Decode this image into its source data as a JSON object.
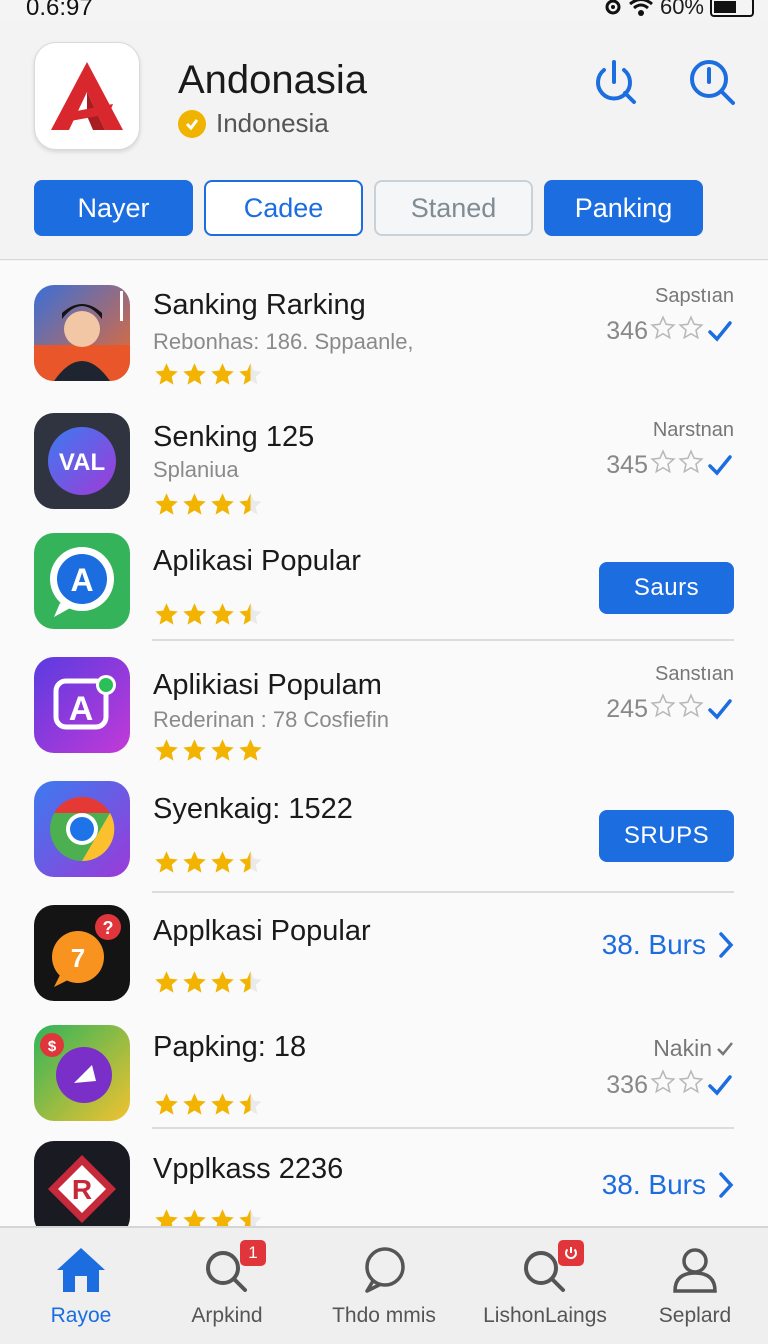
{
  "status_bar": {
    "time": "0.6:97",
    "battery": "60%"
  },
  "header": {
    "app_name": "Andonasia",
    "region": "Indonesia",
    "icons": [
      "power-icon",
      "search-icon"
    ]
  },
  "tabs": [
    {
      "label": "Nayer",
      "style": "filled"
    },
    {
      "label": "Cadee",
      "style": "outline"
    },
    {
      "label": "Staned",
      "style": "muted"
    },
    {
      "label": "Panking",
      "style": "filled"
    }
  ],
  "apps": [
    {
      "title": "Sanking Rarking",
      "subtitle": "Rebonhas: 186. Sppaanle,",
      "rating": 3.5,
      "meta_label": "Sapstıan",
      "meta_value": "346",
      "action": "meta"
    },
    {
      "title": "Senking 125",
      "subtitle": "Splaniua",
      "rating": 3.5,
      "meta_label": "Narstnan",
      "meta_value": "345",
      "action": "meta"
    },
    {
      "title": "Aplikasi Popular",
      "subtitle": "",
      "rating": 3.5,
      "action": "button",
      "button_label": "Saurs"
    },
    {
      "title": "Aplikiasi Populam",
      "subtitle": "Rederinan : 78 Cosfiefin",
      "rating": 4,
      "meta_label": "Sanstıan",
      "meta_value": "245",
      "action": "meta"
    },
    {
      "title": "Syenkaig: 1522",
      "subtitle": "",
      "rating": 3.5,
      "action": "button",
      "button_label": "SRUPS"
    },
    {
      "title": "Applkasi Popular",
      "subtitle": "",
      "rating": 3.5,
      "action": "link",
      "link_label": "38. Burs"
    },
    {
      "title": "Papking: 18",
      "subtitle": "",
      "rating": 3.5,
      "meta_label": "Nakin",
      "meta_value": "336",
      "action": "meta"
    },
    {
      "title": "Vpplkass 2236",
      "subtitle": "",
      "rating": 3.5,
      "action": "link",
      "link_label": "38. Burs"
    }
  ],
  "bottom_nav": [
    {
      "label": "Rayoe",
      "icon": "home-icon",
      "active": true
    },
    {
      "label": "Arpkind",
      "icon": "search-icon",
      "badge": "1"
    },
    {
      "label": "Thdo mmis",
      "icon": "chat-icon"
    },
    {
      "label": "LishonLaings",
      "icon": "search-power-icon"
    },
    {
      "label": "Seplard",
      "icon": "user-icon"
    }
  ],
  "colors": {
    "accent": "#1c6de0",
    "star": "#f2b400",
    "badge": "#e0363b"
  }
}
